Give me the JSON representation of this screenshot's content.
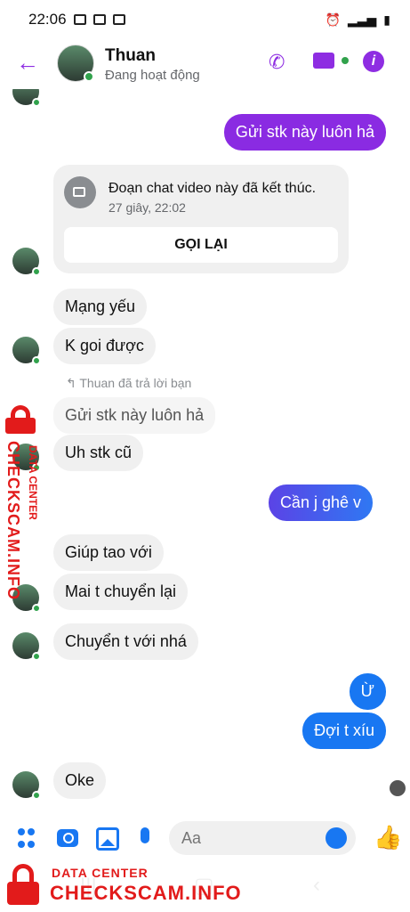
{
  "status_bar": {
    "time": "22:06"
  },
  "header": {
    "name": "Thuan",
    "status": "Đang hoạt động"
  },
  "messages": [
    {
      "text": "Gửi stk này luôn hả"
    },
    {
      "call_title": "Đoạn chat video này đã kết thúc.",
      "call_time": "27 giây, 22:02",
      "recall": "GỌI LẠI"
    },
    {
      "text": "Mạng yếu"
    },
    {
      "text": "K goi được"
    },
    {
      "reply_note": "Thuan đã trả lời bạn",
      "quoted": "Gửi stk này luôn hả"
    },
    {
      "text": "Uh stk cũ"
    },
    {
      "text": "Cần j ghê v"
    },
    {
      "text": "Giúp tao với"
    },
    {
      "text": "Mai t chuyển lại"
    },
    {
      "text": "Chuyển t với nhá"
    },
    {
      "text": "Ừ"
    },
    {
      "text": "Đợi t xíu"
    },
    {
      "text": "Oke"
    }
  ],
  "composer": {
    "placeholder": "Aa"
  },
  "watermark": {
    "small": "DATA CENTER",
    "big": "CHECKSCAM.INFO"
  },
  "icons": [
    "back-arrow-icon",
    "phone-icon",
    "video-icon",
    "info-icon",
    "apps-icon",
    "camera-icon",
    "image-icon",
    "mic-icon",
    "emoji-icon",
    "like-icon"
  ]
}
